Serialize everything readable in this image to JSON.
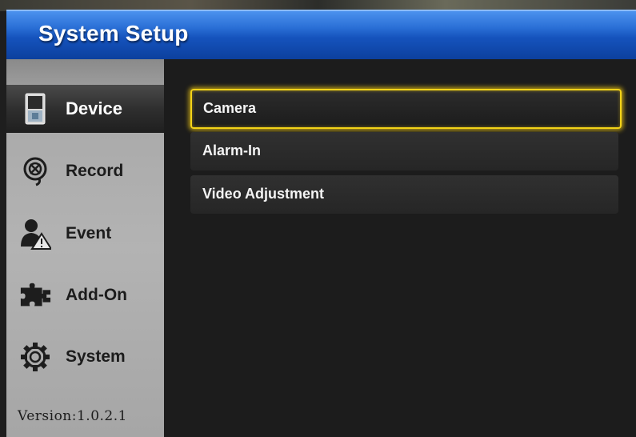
{
  "title": "System Setup",
  "sidebar": {
    "items": [
      {
        "label": "Device",
        "icon": "device-icon",
        "active": true
      },
      {
        "label": "Record",
        "icon": "record-icon",
        "active": false
      },
      {
        "label": "Event",
        "icon": "event-icon",
        "active": false
      },
      {
        "label": "Add-On",
        "icon": "puzzle-icon",
        "active": false
      },
      {
        "label": "System",
        "icon": "gear-icon",
        "active": false
      }
    ],
    "version": "Version:1.0.2.1"
  },
  "menu": {
    "items": [
      {
        "label": "Camera",
        "selected": true
      },
      {
        "label": "Alarm-In",
        "selected": false
      },
      {
        "label": "Video Adjustment",
        "selected": false
      }
    ]
  },
  "colors": {
    "title_bar": "#1553bd",
    "selection_border": "#f3d318",
    "sidebar_bg": "#b3b3b3",
    "main_bg": "#1c1c1c"
  }
}
